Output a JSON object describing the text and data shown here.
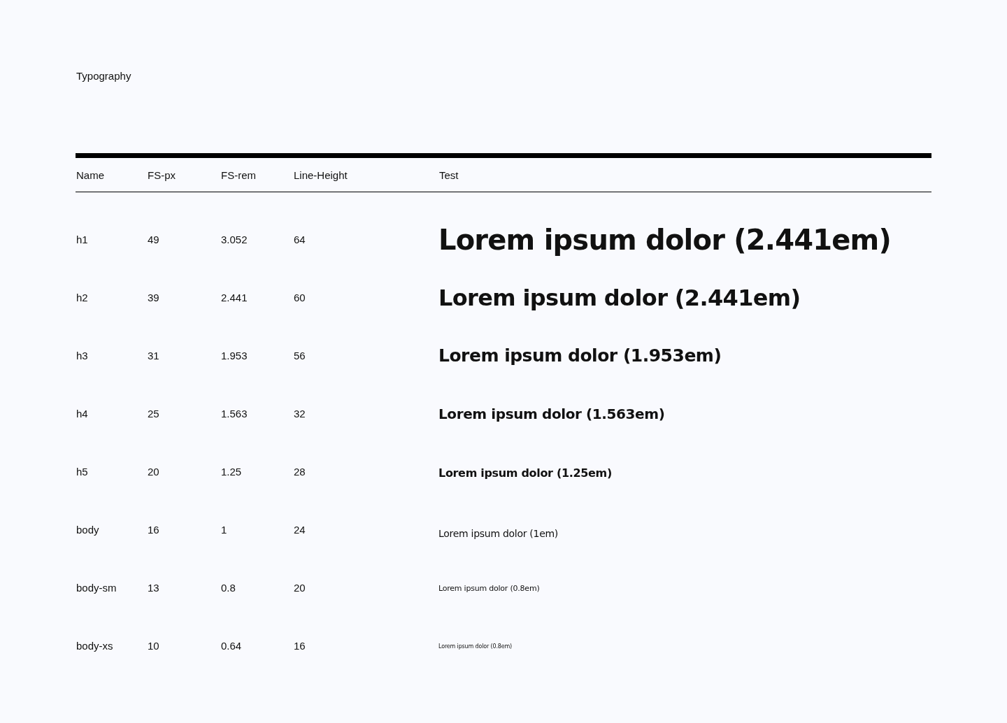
{
  "title": "Typography",
  "table": {
    "columns": [
      "Name",
      "FS-px",
      "FS-rem",
      "Line-Height",
      "Test"
    ],
    "rows": [
      {
        "kind": "h1",
        "cells": [
          "h1",
          "49",
          "3.052",
          "64"
        ],
        "sample": "Lorem ipsum dolor (2.441em)"
      },
      {
        "kind": "h2",
        "cells": [
          "h2",
          "39",
          "2.441",
          "60"
        ],
        "sample": "Lorem ipsum dolor (2.441em)"
      },
      {
        "kind": "h3",
        "cells": [
          "h3",
          "31",
          "1.953",
          "56"
        ],
        "sample": "Lorem ipsum dolor (1.953em)"
      },
      {
        "kind": "h4",
        "cells": [
          "h4",
          "25",
          "1.563",
          "32"
        ],
        "sample": "Lorem ipsum dolor (1.563em)"
      },
      {
        "kind": "h5",
        "cells": [
          "h5",
          "20",
          "1.25",
          "28"
        ],
        "sample": "Lorem ipsum dolor (1.25em)"
      },
      {
        "kind": "body",
        "cells": [
          "body",
          "16",
          "1",
          "24"
        ],
        "sample": "Lorem ipsum dolor (1em)"
      },
      {
        "kind": "body-sm",
        "cells": [
          "body-sm",
          "13",
          "0.8",
          "20"
        ],
        "sample": "Lorem ipsum dolor (0.8em)"
      },
      {
        "kind": "body-xs",
        "cells": [
          "body-xs",
          "10",
          "0.64",
          "16"
        ],
        "sample": "Lorem ipsum dolor (0.8em)"
      }
    ]
  }
}
